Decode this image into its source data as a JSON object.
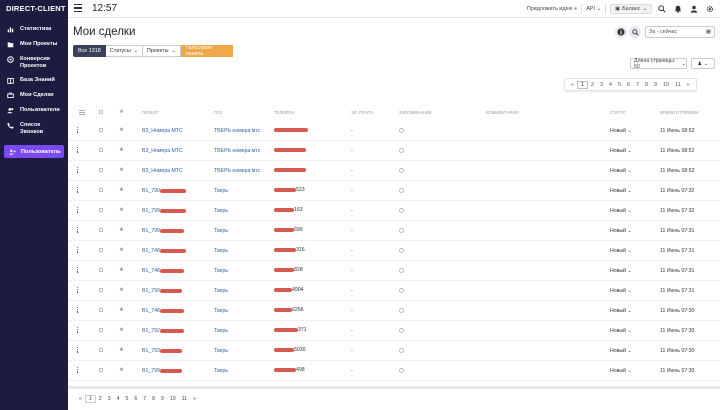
{
  "app": {
    "brand": "DIRECT-CLIENT"
  },
  "sidebar": {
    "items": [
      {
        "label": "Статистика",
        "icon": "chart-icon"
      },
      {
        "label": "Мои Проекты",
        "icon": "folder-icon"
      },
      {
        "label": "Конверсия Проектов",
        "icon": "conversion-icon"
      },
      {
        "label": "База Знаний",
        "icon": "book-icon"
      },
      {
        "label": "Мои Сделки",
        "icon": "deals-icon"
      },
      {
        "label": "Пользователи",
        "icon": "users-icon"
      },
      {
        "label": "Список Звонков",
        "icon": "phone-icon"
      }
    ],
    "user_button": "Пользователь"
  },
  "topbar": {
    "time": "12:57",
    "suggest": "Предложить идею",
    "api": "API",
    "balance": "Баланс"
  },
  "main": {
    "title": "Мои сделки",
    "date_range": "За - сейчас",
    "filters": {
      "all": "Все",
      "all_count": "1318",
      "statuses": "Статусы",
      "projects": "Проекты",
      "voice": "Голосовая панель"
    },
    "page_size": "Длина страницы: 50",
    "pager_top": [
      "«",
      "1",
      "2",
      "3",
      "4",
      "5",
      "6",
      "7",
      "8",
      "9",
      "10",
      "11",
      "»"
    ],
    "columns": {
      "project": "Проект",
      "city": "Гео",
      "phone": "Телефон",
      "spot": "Эл. почта",
      "record": "Запоминание",
      "comment": "Комментарии",
      "status": "Статус",
      "time": "Время отправки"
    },
    "rows": [
      {
        "project": "В3_Номера МТС",
        "project_redact": 0,
        "city": "ТВЕРЬ номера мтс",
        "phone_tail": "",
        "phone_red": 34,
        "spot": "-",
        "status": "Новый",
        "time": "11 Июнь 08:52"
      },
      {
        "project": "В3_Номера МТС",
        "project_redact": 0,
        "city": "ТВЕРЬ номера мтс",
        "phone_tail": "",
        "phone_red": 32,
        "spot": "-",
        "status": "Новый",
        "time": "11 Июнь 08:52"
      },
      {
        "project": "В3_Номера МТС",
        "project_redact": 0,
        "city": "ТВЕРЬ номера мтс",
        "phone_tail": "",
        "phone_red": 32,
        "spot": "-",
        "status": "Новый",
        "time": "11 Июнь 08:52"
      },
      {
        "project": "В1_790",
        "project_redact": 26,
        "city": "Тверь",
        "phone_tail": "523",
        "phone_red": 22,
        "spot": "-",
        "status": "Новый",
        "time": "11 Июнь 07:32"
      },
      {
        "project": "В1_799",
        "project_redact": 26,
        "city": "Тверь",
        "phone_tail": "163",
        "phone_red": 20,
        "spot": "-",
        "status": "Новый",
        "time": "11 Июнь 07:32"
      },
      {
        "project": "В1_799",
        "project_redact": 24,
        "city": "Тверь",
        "phone_tail": "699",
        "phone_red": 20,
        "spot": "-",
        "status": "Новый",
        "time": "11 Июнь 07:31"
      },
      {
        "project": "В1_748",
        "project_redact": 26,
        "city": "Тверь",
        "phone_tail": "316",
        "phone_red": 22,
        "spot": "-",
        "status": "Новый",
        "time": "11 Июнь 07:31"
      },
      {
        "project": "В1_748",
        "project_redact": 24,
        "city": "Тверь",
        "phone_tail": "828",
        "phone_red": 20,
        "spot": "-",
        "status": "Новый",
        "time": "11 Июнь 07:31"
      },
      {
        "project": "В1_790",
        "project_redact": 22,
        "city": "Тверь",
        "phone_tail": "4904",
        "phone_red": 18,
        "spot": "-",
        "status": "Новый",
        "time": "11 Июнь 07:31"
      },
      {
        "project": "В1_748",
        "project_redact": 24,
        "city": "Тверь",
        "phone_tail": "6256",
        "phone_red": 18,
        "spot": "-",
        "status": "Новый",
        "time": "11 Июнь 07:30"
      },
      {
        "project": "В1_792",
        "project_redact": 24,
        "city": "Тверь",
        "phone_tail": "371",
        "phone_red": 24,
        "spot": "-",
        "status": "Новый",
        "time": "11 Июнь 07:30"
      },
      {
        "project": "В1_793",
        "project_redact": 22,
        "city": "Тверь",
        "phone_tail": "5030",
        "phone_red": 20,
        "spot": "-",
        "status": "Новый",
        "time": "11 Июнь 07:30"
      },
      {
        "project": "В1_799",
        "project_redact": 22,
        "city": "Тверь",
        "phone_tail": "498",
        "phone_red": 22,
        "spot": "-",
        "status": "Новый",
        "time": "11 Июнь 07:30"
      }
    ],
    "pager_bottom": [
      "«",
      "1",
      "2",
      "3",
      "4",
      "5",
      "6",
      "7",
      "8",
      "9",
      "10",
      "11",
      "»"
    ]
  },
  "colors": {
    "sidebar": "#1b1c3f",
    "accent": "#7a4af5",
    "voice": "#f1a84a",
    "redact": "#d6584e",
    "link": "#2f5fae"
  }
}
